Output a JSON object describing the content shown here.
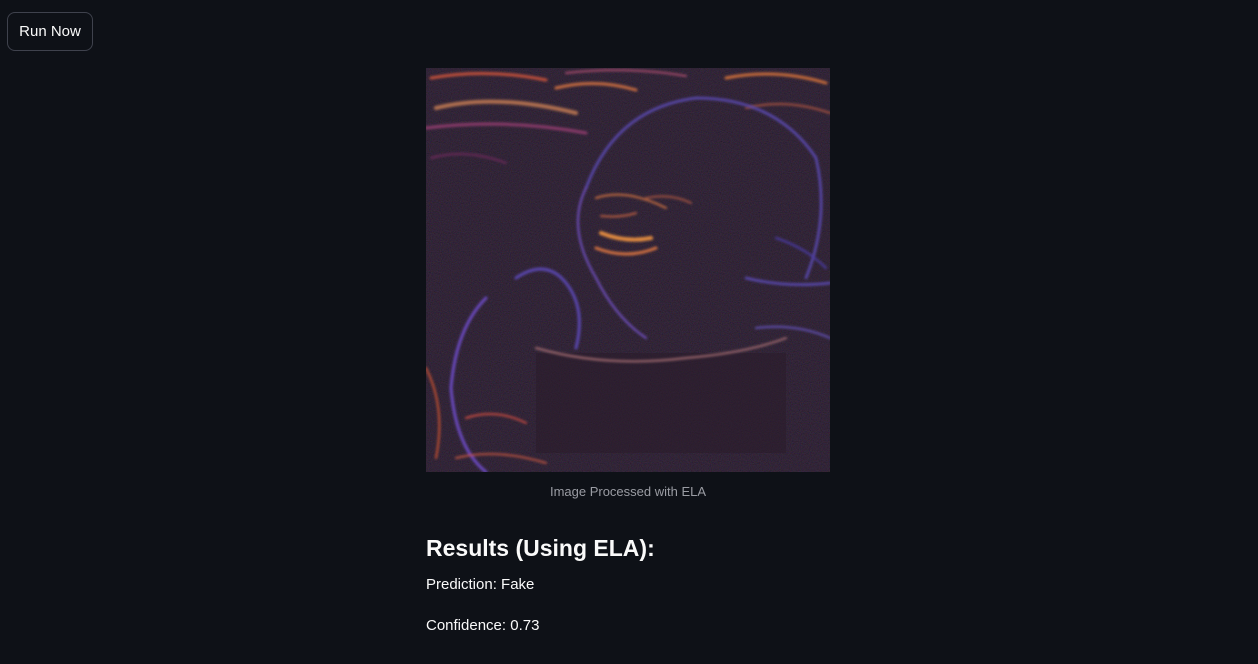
{
  "toolbar": {
    "run_label": "Run Now"
  },
  "image": {
    "caption": "Image Processed with ELA"
  },
  "results": {
    "heading": "Results (Using ELA):",
    "prediction": "Prediction: Fake",
    "confidence": "Confidence: 0.73"
  },
  "colors": {
    "background": "#0e1117",
    "text": "#fafafa",
    "caption": "#9a9ca3",
    "button_border": "#3f424d"
  }
}
